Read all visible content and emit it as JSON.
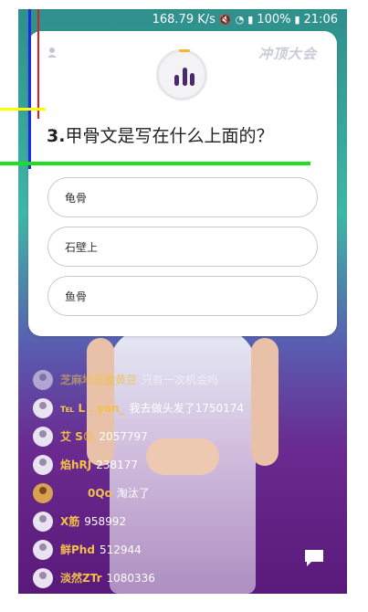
{
  "status_bar": {
    "speed": "168.79 K/s",
    "battery": "100%",
    "time": "21:06"
  },
  "brand": {
    "logo_text": "冲顶大会"
  },
  "question": {
    "number": "3.",
    "text": "甲骨文是写在什么上面的？"
  },
  "options": [
    {
      "label": "龟骨"
    },
    {
      "label": "石壁上"
    },
    {
      "label": "鱼骨"
    }
  ],
  "chat": [
    {
      "name": "芝麻地里撒黄豆",
      "message": "只有一次机会吗",
      "faded": true
    },
    {
      "name": "℡ L . yan_",
      "message": "我去做头发了1750174",
      "faded": false
    },
    {
      "name": "艾 S😊",
      "message": "2057797",
      "faded": false
    },
    {
      "name": "焰hRJ",
      "message": "238177",
      "faded": false
    },
    {
      "name": "0Qo",
      "message": "淘汰了",
      "faded": false,
      "photo": true
    },
    {
      "name": "X筋",
      "message": "958992",
      "faded": false
    },
    {
      "name": "鲜Phd",
      "message": "512944",
      "faded": false
    },
    {
      "name": "淡然ZTr",
      "message": "1080336",
      "faded": false
    }
  ],
  "colors": {
    "accent": "#f2c14a",
    "timer_arc": "#f2b630",
    "bars": "#4b2a6b"
  }
}
